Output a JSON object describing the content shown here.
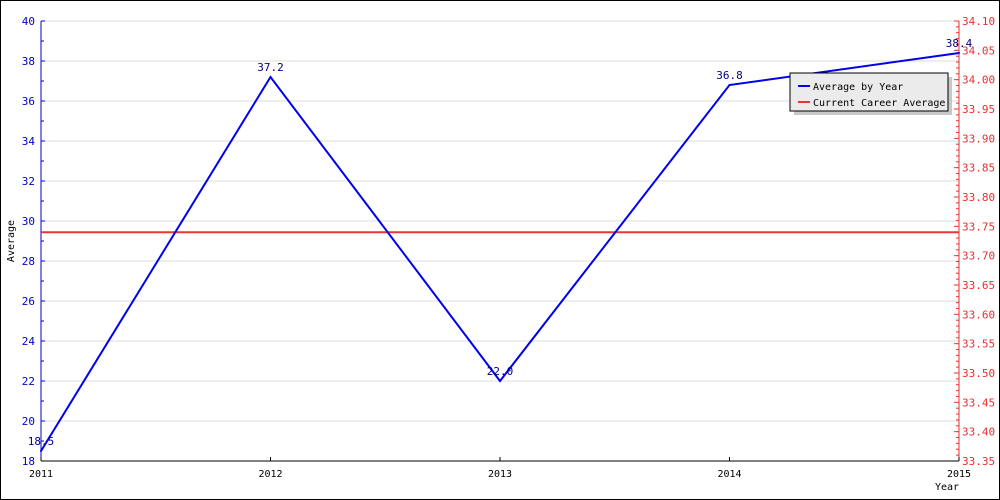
{
  "chart_data": {
    "type": "line",
    "title": "",
    "xlabel": "Year",
    "ylabel": "Average",
    "x": [
      "2011",
      "2012",
      "2013",
      "2014",
      "2015"
    ],
    "series": [
      {
        "name": "Average by Year",
        "axis": "left",
        "color": "#0000ee",
        "values": [
          18.5,
          37.2,
          22.0,
          36.8,
          38.4
        ],
        "labels": [
          "18.5",
          "37.2",
          "22.0",
          "36.8",
          "38.4"
        ]
      },
      {
        "name": "Current Career Average",
        "axis": "right",
        "color": "#ee3333",
        "value": 33.74
      }
    ],
    "y_left": {
      "range": [
        18,
        40
      ],
      "ticks": [
        18,
        20,
        22,
        24,
        26,
        28,
        30,
        32,
        34,
        36,
        38,
        40
      ],
      "minor_step": 1,
      "color": "#0000cc"
    },
    "y_right": {
      "range": [
        33.35,
        34.1
      ],
      "ticks": [
        "33.35",
        "33.40",
        "33.45",
        "33.50",
        "33.55",
        "33.60",
        "33.65",
        "33.70",
        "33.75",
        "33.80",
        "33.85",
        "33.90",
        "33.95",
        "34.00",
        "34.05",
        "34.10"
      ],
      "minor_step": 0.01,
      "color": "#e83030"
    },
    "grid": true,
    "legend": {
      "position": "top-right",
      "entries": [
        "Average by Year",
        "Current Career Average"
      ]
    }
  }
}
